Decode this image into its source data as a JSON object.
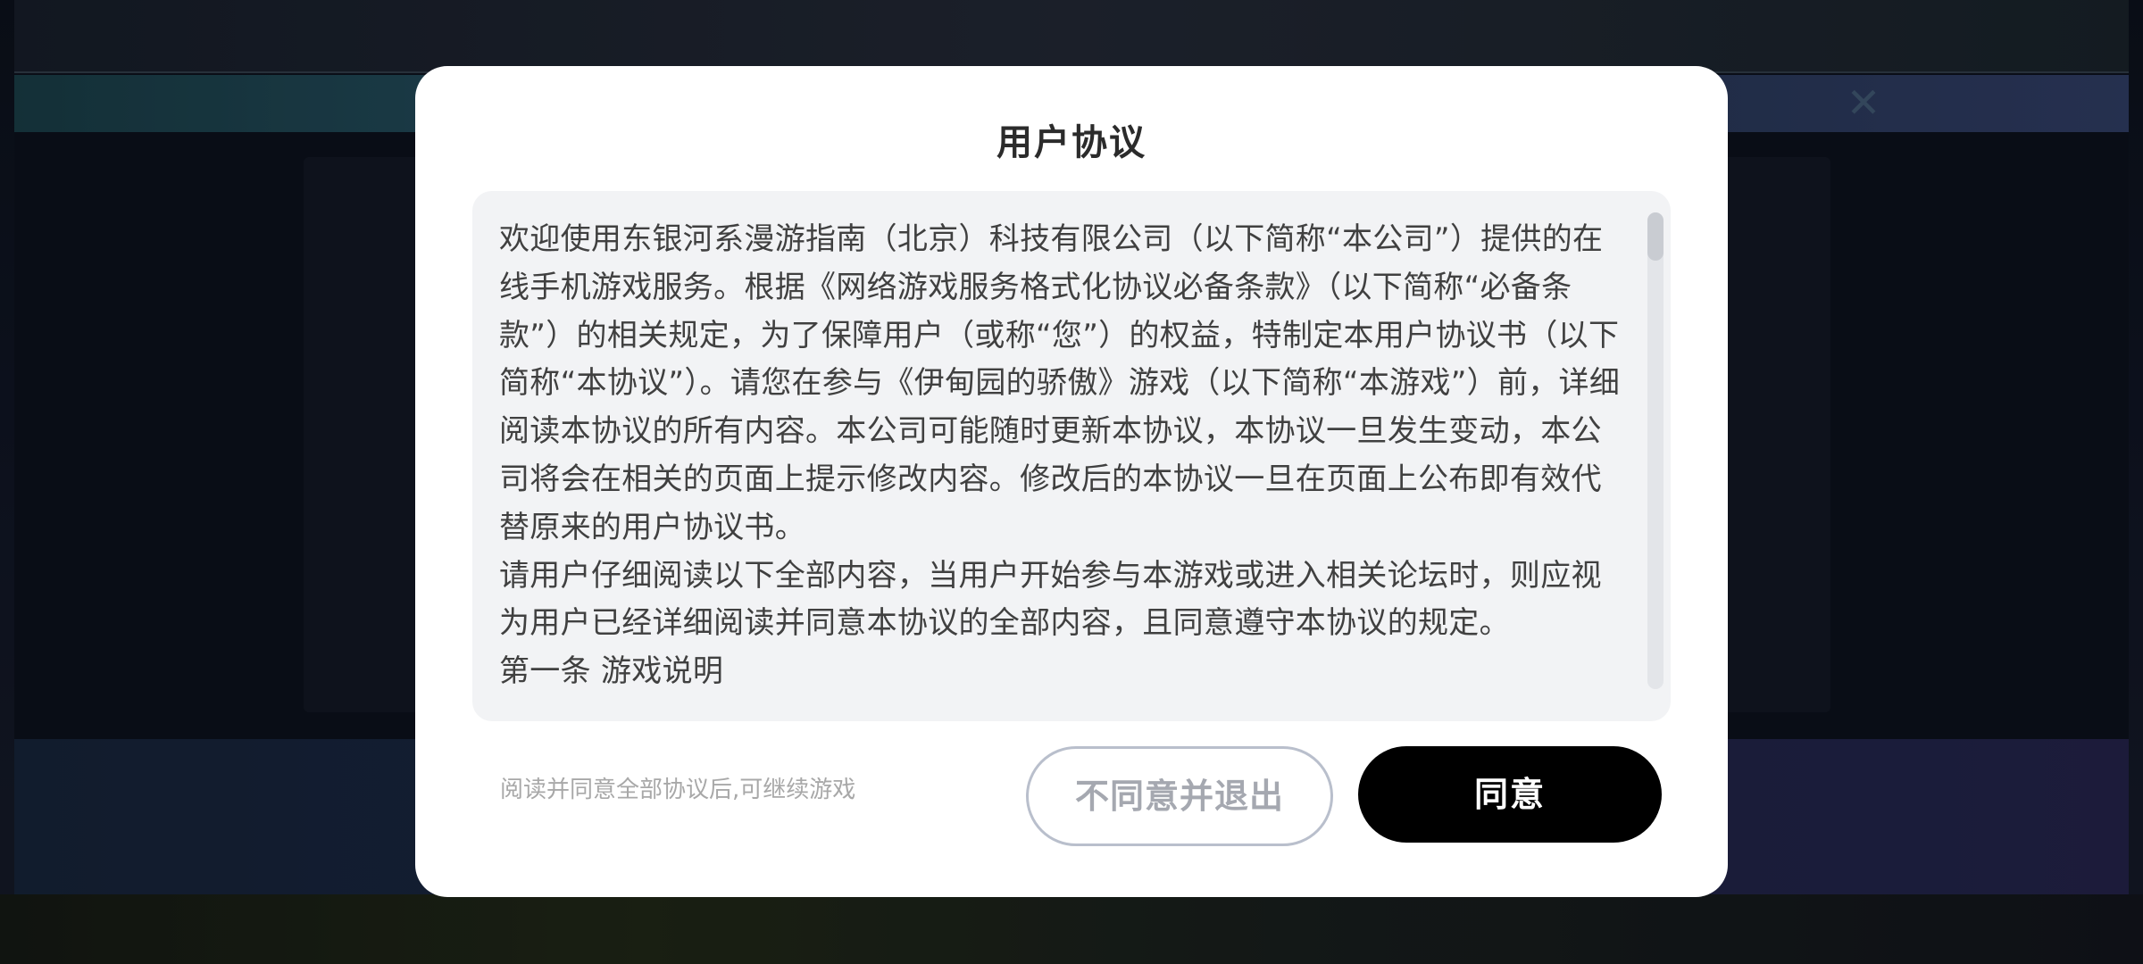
{
  "dialog": {
    "title": "用户协议",
    "paragraphs": [
      "欢迎使用东银河系漫游指南（北京）科技有限公司（以下简称“本公司”）提供的在线手机游戏服务。根据《网络游戏服务格式化协议必备条款》（以下简称“必备条款”）的相关规定，为了保障用户（或称“您”）的权益，特制定本用户协议书（以下简称“本协议”）。请您在参与《伊甸园的骄傲》游戏（以下简称“本游戏”）前，详细阅读本协议的所有内容。本公司可能随时更新本协议，本协议一旦发生变动，本公司将会在相关的页面上提示修改内容。修改后的本协议一旦在页面上公布即有效代替原来的用户协议书。",
      "请用户仔细阅读以下全部内容，当用户开始参与本游戏或进入相关论坛时，则应视为用户已经详细阅读并同意本协议的全部内容，且同意遵守本协议的规定。",
      "第一条 游戏说明"
    ],
    "hint": "阅读并同意全部协议后,可继续游戏",
    "decline_label": "不同意并退出",
    "agree_label": "同意"
  },
  "background": {
    "close_icon": "close-icon"
  },
  "colors": {
    "agree_button": "#000000",
    "decline_border": "#b9bfcc",
    "text_box_bg": "#f2f3f5"
  }
}
